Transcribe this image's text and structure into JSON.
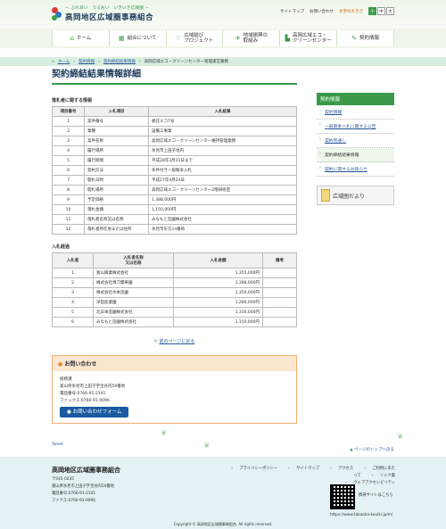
{
  "header": {
    "tagline": "— ふれあい　うるおい　いきいき広域圏 —",
    "title": "高岡地区広域圏事務組合",
    "util": {
      "sitemap": "サイトマップ",
      "contact": "お問い合わせ",
      "font_size_label": "文字の大きさ",
      "font_small": "小",
      "font_medium": "中",
      "font_large": "大"
    }
  },
  "nav": [
    {
      "label": "ホーム",
      "icon": "home-icon",
      "glyph": "⌂"
    },
    {
      "label": "組合について",
      "icon": "building-icon",
      "glyph": "▦"
    },
    {
      "label": "広域結び\nプロジェクト",
      "icon": "heart-icon",
      "glyph": "♡"
    },
    {
      "label": "地域振興の\n取組み",
      "icon": "map-icon",
      "glyph": "✈"
    },
    {
      "label": "高岡広域エコ・\nクリーンセンター",
      "icon": "factory-icon",
      "glyph": "▙"
    },
    {
      "label": "契約情報",
      "icon": "contract-icon",
      "glyph": "✎"
    }
  ],
  "breadcrumb": {
    "home": "ホーム",
    "b1": "契約情報",
    "b2": "契約締結結果情報",
    "current": "高岡広域エコ・クリーンセンター管理運営業務"
  },
  "main": {
    "title": "契約締結結果情報詳細",
    "award_heading": "落札者に関する情報",
    "award_headers": [
      "項目番号",
      "入札項目",
      "入札結果"
    ],
    "award_rows": [
      [
        "1",
        "案件番号",
        "委託エコ7号"
      ],
      [
        "2",
        "業種",
        "設備工事業"
      ],
      [
        "3",
        "案件名称",
        "高岡広域エコ・クリーンセンター維持管理業務"
      ],
      [
        "4",
        "履行場所",
        "氷見市上田子地内"
      ],
      [
        "5",
        "履行期間",
        "平成28年3月31日まで"
      ],
      [
        "6",
        "契約方法",
        "条件付き一般競争入札"
      ],
      [
        "7",
        "開札日時",
        "平成27年4月24日"
      ],
      [
        "8",
        "開札場所",
        "高岡広域エコ・クリーンセンター2階研修室"
      ],
      [
        "9",
        "予定価格",
        "1,388,000円"
      ],
      [
        "10",
        "落札金額",
        "1,150,000円"
      ],
      [
        "11",
        "落札者名称又は名称",
        "みなもと造園株式会社"
      ],
      [
        "12",
        "落札者所在地または住所",
        "氷見市矢方14番地"
      ]
    ],
    "bid_heading": "入札経過",
    "bid_headers": [
      "入札者",
      "入札者名称\n又は名称",
      "入札金額",
      "備考"
    ],
    "bid_rows": [
      [
        "1",
        "富山興業株式会社",
        "1,355,000円",
        ""
      ],
      [
        "2",
        "株式会社専刀電華園",
        "1,388,000円",
        ""
      ],
      [
        "3",
        "株式会社水本造園",
        "1,350,000円",
        ""
      ],
      [
        "4",
        "深田産業園",
        "1,280,000円",
        ""
      ],
      [
        "5",
        "北日本造園株式会社",
        "1,330,000円",
        ""
      ],
      [
        "6",
        "みなもと造園株式会社",
        "1,150,000円",
        ""
      ]
    ],
    "back_link": "前のページに戻る"
  },
  "inquiry": {
    "title": "お問い合わせ",
    "dept": "総務課",
    "address": "富山県氷見市上田子字宝谷内50番地",
    "tel": "電話番号:0766-91-2101",
    "fax": "ファックス:0766-91-9096",
    "button": "お問い合わせフォーム"
  },
  "sidebar": {
    "heading": "契約情報",
    "items": [
      {
        "label": "契約情報",
        "current": false
      },
      {
        "label": "一般競争入札に関する公告",
        "current": false
      },
      {
        "label": "契約見通し",
        "current": false
      },
      {
        "label": "契約締結結果情報",
        "current": true
      },
      {
        "label": "契約に関するお知らせ",
        "current": false
      }
    ],
    "banner": "広域圏だより"
  },
  "tweet": "Tweet",
  "pagetop": "ページのトップへ戻る",
  "footer": {
    "org": "高岡地区広域圏事務組合",
    "zip": "〒935-0035",
    "address": "富山県氷見市上田子字宝谷内50番地",
    "tel": "電話番号:0766-91-2101",
    "fax": "ファクス:0766-91-9096",
    "links": [
      "プライバシーポリシー",
      "サイトマップ",
      "アクセス",
      "ご利用にあたって",
      "リンク集",
      "ウェブアクセシビリティ"
    ],
    "mobile": "携帯サイトはこちら",
    "url": "https://www.takaoka-kouiki.jp/m/",
    "copyright": "Copyright © 高岡地区広域圏事務組合. All rights reserved."
  },
  "colors": {
    "accent": "#3a9a4a",
    "title": "#1a3a5a",
    "link": "#2a5a9a",
    "inquiry_border": "#f0b070"
  }
}
